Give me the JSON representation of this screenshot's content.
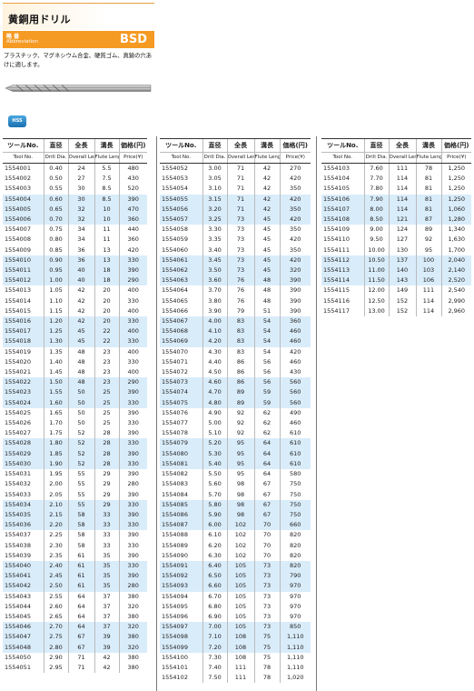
{
  "header": {
    "title": "黄銅用ドリル",
    "abbr_jp": "略 番",
    "abbr_en": "Abbreviation",
    "abbr_code": "BSD",
    "description": "プラスチック、マグネシウム合金、硬質ゴム、真鍮の穴あけに適します。",
    "badge": "HSS",
    "accent": "#f59a23",
    "stripe": "#d9ecfa"
  },
  "table": {
    "headers_jp": [
      "ツールNo.",
      "直径",
      "全長",
      "溝長",
      "価格(円)"
    ],
    "headers_en": [
      "Tool No.",
      "Drill Dia.",
      "Overall Length",
      "Flute Length",
      "Price(¥)"
    ],
    "col1": [
      [
        "1554001",
        "0.40",
        "24",
        "5.5",
        "480"
      ],
      [
        "1554002",
        "0.50",
        "27",
        "7.5",
        "430"
      ],
      [
        "1554003",
        "0.55",
        "30",
        "8.5",
        "520"
      ],
      [
        "1554004",
        "0.60",
        "30",
        "8.5",
        "390"
      ],
      [
        "1554005",
        "0.65",
        "32",
        "10",
        "470"
      ],
      [
        "1554006",
        "0.70",
        "32",
        "10",
        "360"
      ],
      [
        "1554007",
        "0.75",
        "34",
        "11",
        "440"
      ],
      [
        "1554008",
        "0.80",
        "34",
        "11",
        "360"
      ],
      [
        "1554009",
        "0.85",
        "36",
        "13",
        "420"
      ],
      [
        "1554010",
        "0.90",
        "36",
        "13",
        "330"
      ],
      [
        "1554011",
        "0.95",
        "40",
        "18",
        "390"
      ],
      [
        "1554012",
        "1.00",
        "40",
        "18",
        "290"
      ],
      [
        "1554013",
        "1.05",
        "42",
        "20",
        "400"
      ],
      [
        "1554014",
        "1.10",
        "42",
        "20",
        "330"
      ],
      [
        "1554015",
        "1.15",
        "42",
        "20",
        "400"
      ],
      [
        "1554016",
        "1.20",
        "42",
        "20",
        "330"
      ],
      [
        "1554017",
        "1.25",
        "45",
        "22",
        "400"
      ],
      [
        "1554018",
        "1.30",
        "45",
        "22",
        "330"
      ],
      [
        "1554019",
        "1.35",
        "48",
        "23",
        "400"
      ],
      [
        "1554020",
        "1.40",
        "48",
        "23",
        "330"
      ],
      [
        "1554021",
        "1.45",
        "48",
        "23",
        "400"
      ],
      [
        "1554022",
        "1.50",
        "48",
        "23",
        "290"
      ],
      [
        "1554023",
        "1.55",
        "50",
        "25",
        "390"
      ],
      [
        "1554024",
        "1.60",
        "50",
        "25",
        "330"
      ],
      [
        "1554025",
        "1.65",
        "50",
        "25",
        "390"
      ],
      [
        "1554026",
        "1.70",
        "50",
        "25",
        "330"
      ],
      [
        "1554027",
        "1.75",
        "52",
        "28",
        "390"
      ],
      [
        "1554028",
        "1.80",
        "52",
        "28",
        "330"
      ],
      [
        "1554029",
        "1.85",
        "52",
        "28",
        "390"
      ],
      [
        "1554030",
        "1.90",
        "52",
        "28",
        "330"
      ],
      [
        "1554031",
        "1.95",
        "55",
        "29",
        "390"
      ],
      [
        "1554032",
        "2.00",
        "55",
        "29",
        "280"
      ],
      [
        "1554033",
        "2.05",
        "55",
        "29",
        "390"
      ],
      [
        "1554034",
        "2.10",
        "55",
        "29",
        "330"
      ],
      [
        "1554035",
        "2.15",
        "58",
        "33",
        "390"
      ],
      [
        "1554036",
        "2.20",
        "58",
        "33",
        "330"
      ],
      [
        "1554037",
        "2.25",
        "58",
        "33",
        "390"
      ],
      [
        "1554038",
        "2.30",
        "58",
        "33",
        "330"
      ],
      [
        "1554039",
        "2.35",
        "61",
        "35",
        "390"
      ],
      [
        "1554040",
        "2.40",
        "61",
        "35",
        "330"
      ],
      [
        "1554041",
        "2.45",
        "61",
        "35",
        "390"
      ],
      [
        "1554042",
        "2.50",
        "61",
        "35",
        "280"
      ],
      [
        "1554043",
        "2.55",
        "64",
        "37",
        "380"
      ],
      [
        "1554044",
        "2.60",
        "64",
        "37",
        "320"
      ],
      [
        "1554045",
        "2.65",
        "64",
        "37",
        "380"
      ],
      [
        "1554046",
        "2.70",
        "64",
        "37",
        "320"
      ],
      [
        "1554047",
        "2.75",
        "67",
        "39",
        "380"
      ],
      [
        "1554048",
        "2.80",
        "67",
        "39",
        "320"
      ],
      [
        "1554050",
        "2.90",
        "71",
        "42",
        "380"
      ],
      [
        "1554051",
        "2.95",
        "71",
        "42",
        "380"
      ]
    ],
    "col2": [
      [
        "1554052",
        "3.00",
        "71",
        "42",
        "270"
      ],
      [
        "1554053",
        "3.05",
        "71",
        "42",
        "420"
      ],
      [
        "1554054",
        "3.10",
        "71",
        "42",
        "350"
      ],
      [
        "1554055",
        "3.15",
        "71",
        "42",
        "420"
      ],
      [
        "1554056",
        "3.20",
        "71",
        "42",
        "350"
      ],
      [
        "1554057",
        "3.25",
        "73",
        "45",
        "420"
      ],
      [
        "1554058",
        "3.30",
        "73",
        "45",
        "350"
      ],
      [
        "1554059",
        "3.35",
        "73",
        "45",
        "420"
      ],
      [
        "1554060",
        "3.40",
        "73",
        "45",
        "350"
      ],
      [
        "1554061",
        "3.45",
        "73",
        "45",
        "420"
      ],
      [
        "1554062",
        "3.50",
        "73",
        "45",
        "320"
      ],
      [
        "1554063",
        "3.60",
        "76",
        "48",
        "390"
      ],
      [
        "1554064",
        "3.70",
        "76",
        "48",
        "390"
      ],
      [
        "1554065",
        "3.80",
        "76",
        "48",
        "390"
      ],
      [
        "1554066",
        "3.90",
        "79",
        "51",
        "390"
      ],
      [
        "1554067",
        "4.00",
        "83",
        "54",
        "360"
      ],
      [
        "1554068",
        "4.10",
        "83",
        "54",
        "460"
      ],
      [
        "1554069",
        "4.20",
        "83",
        "54",
        "460"
      ],
      [
        "1554070",
        "4.30",
        "83",
        "54",
        "420"
      ],
      [
        "1554071",
        "4.40",
        "86",
        "56",
        "460"
      ],
      [
        "1554072",
        "4.50",
        "86",
        "56",
        "430"
      ],
      [
        "1554073",
        "4.60",
        "86",
        "56",
        "560"
      ],
      [
        "1554074",
        "4.70",
        "89",
        "59",
        "560"
      ],
      [
        "1554075",
        "4.80",
        "89",
        "59",
        "560"
      ],
      [
        "1554076",
        "4.90",
        "92",
        "62",
        "490"
      ],
      [
        "1554077",
        "5.00",
        "92",
        "62",
        "460"
      ],
      [
        "1554078",
        "5.10",
        "92",
        "62",
        "610"
      ],
      [
        "1554079",
        "5.20",
        "95",
        "64",
        "610"
      ],
      [
        "1554080",
        "5.30",
        "95",
        "64",
        "610"
      ],
      [
        "1554081",
        "5.40",
        "95",
        "64",
        "610"
      ],
      [
        "1554082",
        "5.50",
        "95",
        "64",
        "580"
      ],
      [
        "1554083",
        "5.60",
        "98",
        "67",
        "750"
      ],
      [
        "1554084",
        "5.70",
        "98",
        "67",
        "750"
      ],
      [
        "1554085",
        "5.80",
        "98",
        "67",
        "750"
      ],
      [
        "1554086",
        "5.90",
        "98",
        "67",
        "750"
      ],
      [
        "1554087",
        "6.00",
        "102",
        "70",
        "660"
      ],
      [
        "1554088",
        "6.10",
        "102",
        "70",
        "820"
      ],
      [
        "1554089",
        "6.20",
        "102",
        "70",
        "820"
      ],
      [
        "1554090",
        "6.30",
        "102",
        "70",
        "820"
      ],
      [
        "1554091",
        "6.40",
        "105",
        "73",
        "820"
      ],
      [
        "1554092",
        "6.50",
        "105",
        "73",
        "790"
      ],
      [
        "1554093",
        "6.60",
        "105",
        "73",
        "970"
      ],
      [
        "1554094",
        "6.70",
        "105",
        "73",
        "970"
      ],
      [
        "1554095",
        "6.80",
        "105",
        "73",
        "970"
      ],
      [
        "1554096",
        "6.90",
        "105",
        "73",
        "970"
      ],
      [
        "1554097",
        "7.00",
        "105",
        "73",
        "850"
      ],
      [
        "1554098",
        "7.10",
        "108",
        "75",
        "1,110"
      ],
      [
        "1554099",
        "7.20",
        "108",
        "75",
        "1,110"
      ],
      [
        "1554100",
        "7.30",
        "108",
        "75",
        "1,110"
      ],
      [
        "1554101",
        "7.40",
        "111",
        "78",
        "1,110"
      ],
      [
        "1554102",
        "7.50",
        "111",
        "78",
        "1,020"
      ]
    ],
    "col3": [
      [
        "1554103",
        "7.60",
        "111",
        "78",
        "1,250"
      ],
      [
        "1554104",
        "7.70",
        "114",
        "81",
        "1,250"
      ],
      [
        "1554105",
        "7.80",
        "114",
        "81",
        "1,250"
      ],
      [
        "1554106",
        "7.90",
        "114",
        "81",
        "1,250"
      ],
      [
        "1554107",
        "8.00",
        "114",
        "81",
        "1,060"
      ],
      [
        "1554108",
        "8.50",
        "121",
        "87",
        "1,280"
      ],
      [
        "1554109",
        "9.00",
        "124",
        "89",
        "1,340"
      ],
      [
        "1554110",
        "9.50",
        "127",
        "92",
        "1,630"
      ],
      [
        "1554111",
        "10.00",
        "130",
        "95",
        "1,700"
      ],
      [
        "1554112",
        "10.50",
        "137",
        "100",
        "2,040"
      ],
      [
        "1554113",
        "11.00",
        "140",
        "103",
        "2,140"
      ],
      [
        "1554114",
        "11.50",
        "143",
        "106",
        "2,520"
      ],
      [
        "1554115",
        "12.00",
        "149",
        "111",
        "2,540"
      ],
      [
        "1554116",
        "12.50",
        "152",
        "114",
        "2,990"
      ],
      [
        "1554117",
        "13.00",
        "152",
        "114",
        "2,960"
      ]
    ]
  }
}
